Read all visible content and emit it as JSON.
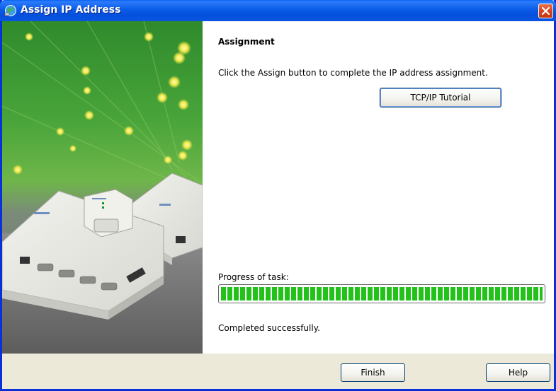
{
  "window": {
    "title": "Assign IP Address",
    "icon": "network-globe-icon",
    "title_bar_color": "#0a5ce8",
    "close_button_color": "#d8421c"
  },
  "banner": {
    "image": "fiber-optic-device-servers-illustration"
  },
  "content": {
    "heading": "Assignment",
    "instructions": "Click the Assign button to complete the IP address assignment.",
    "tutorial_button": "TCP/IP Tutorial",
    "progress_label": "Progress of task:",
    "progress_fraction": 1.0,
    "progress_color": "#22c21b",
    "status": "Completed successfully."
  },
  "footer": {
    "finish_button": "Finish",
    "help_button": "Help"
  }
}
